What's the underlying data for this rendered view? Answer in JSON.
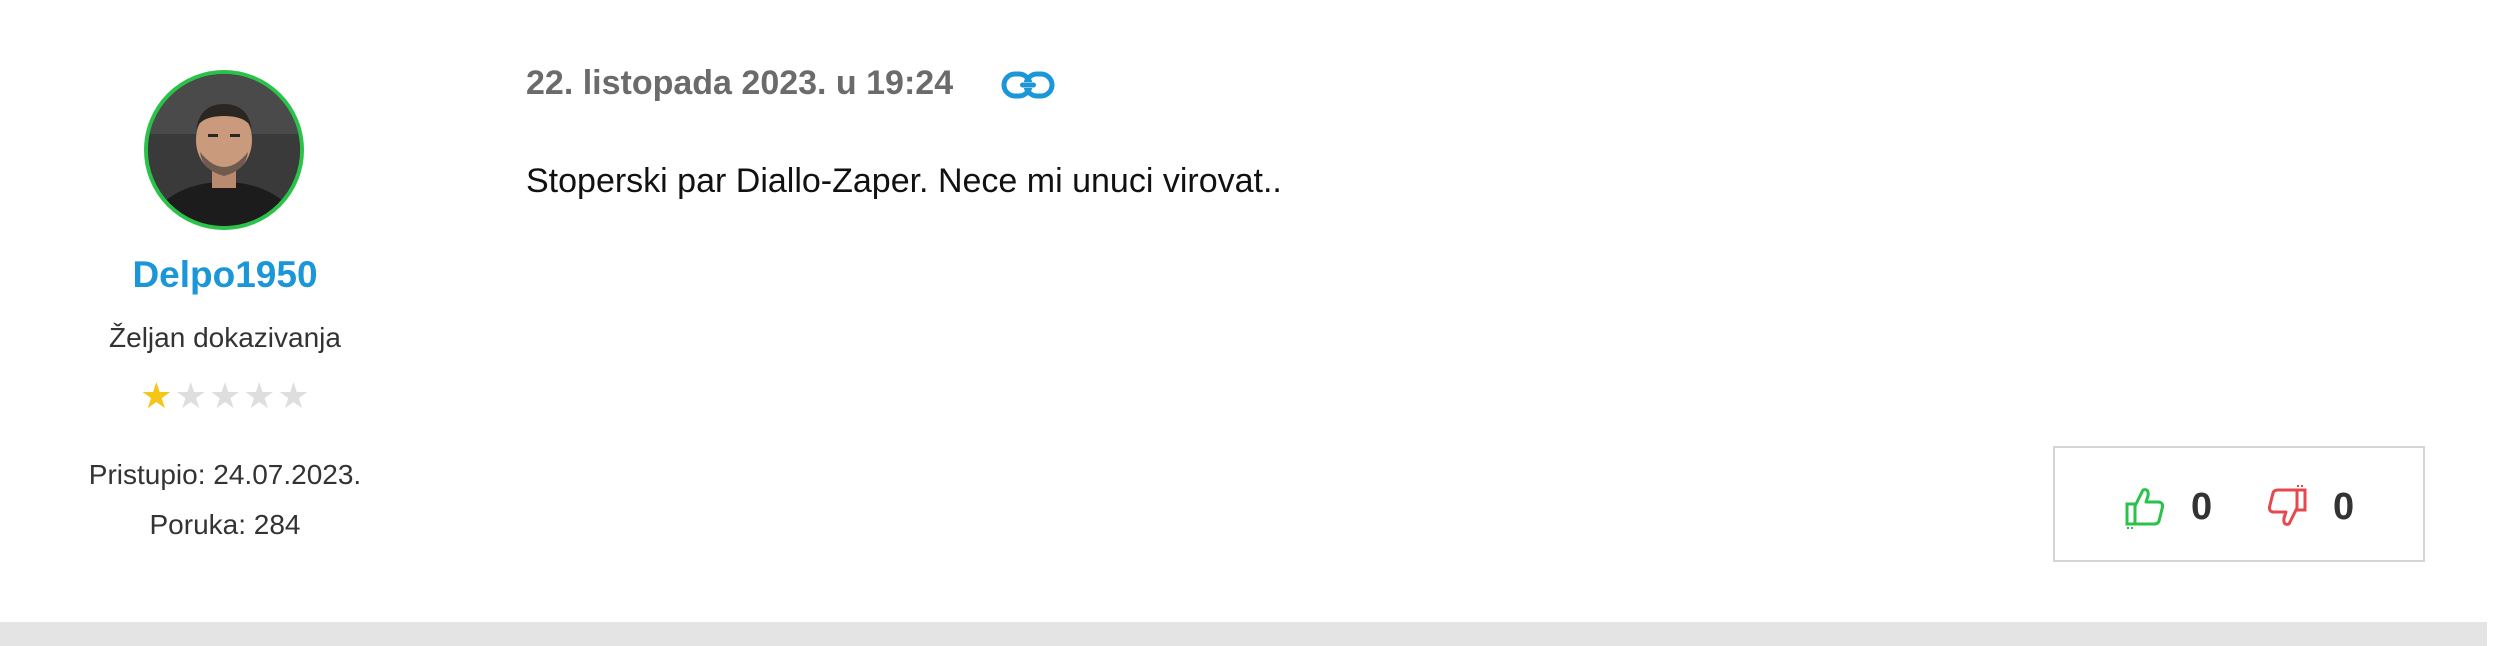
{
  "author": {
    "username": "Delpo1950",
    "rank": "Željan dokazivanja",
    "stars_filled": 1,
    "stars_total": 5,
    "joined": "Pristupio: 24.07.2023.",
    "posts": "Poruka: 284",
    "avatar_ring_color": "#2bc24a"
  },
  "post": {
    "date": "22. listopada 2023. u 19:24",
    "permalink_icon": "link-icon",
    "body": "Stoperski par Diallo-Zaper. Nece mi unuci virovat.."
  },
  "votes": {
    "up_icon": "thumbs-up-icon",
    "up_count": "0",
    "up_color": "#2bc24a",
    "down_icon": "thumbs-down-icon",
    "down_count": "0",
    "down_color": "#e5484d"
  },
  "colors": {
    "username": "#1a96d9",
    "link_icon": "#1a96d9",
    "star_on": "#f5c518",
    "star_off": "#dedede"
  }
}
